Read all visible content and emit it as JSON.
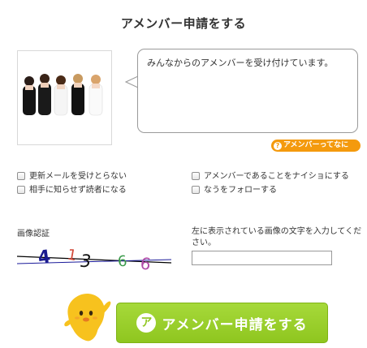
{
  "page": {
    "title": "アメンバー申請をする"
  },
  "profile": {
    "message": "みんなからのアメンバーを受け付けています。"
  },
  "help_link": {
    "label": "アメンバーってなに",
    "icon": "question-circle-icon"
  },
  "options": [
    {
      "label": "更新メールを受けとらない",
      "checked": false
    },
    {
      "label": "アメンバーであることをナイショにする",
      "checked": false
    },
    {
      "label": "相手に知らせず読者になる",
      "checked": false
    },
    {
      "label": "なうをフォローする",
      "checked": false
    }
  ],
  "captcha": {
    "label": "画像認証",
    "characters": [
      "4",
      "1",
      "3",
      "6",
      "6"
    ],
    "instruction": "左に表示されている画像の文字を入力してください。",
    "input_value": ""
  },
  "submit": {
    "label": "アメンバー申請をする",
    "logo_letter": "ア"
  },
  "colors": {
    "accent_green": "#8fc61f",
    "badge_orange": "#f49a0d"
  }
}
